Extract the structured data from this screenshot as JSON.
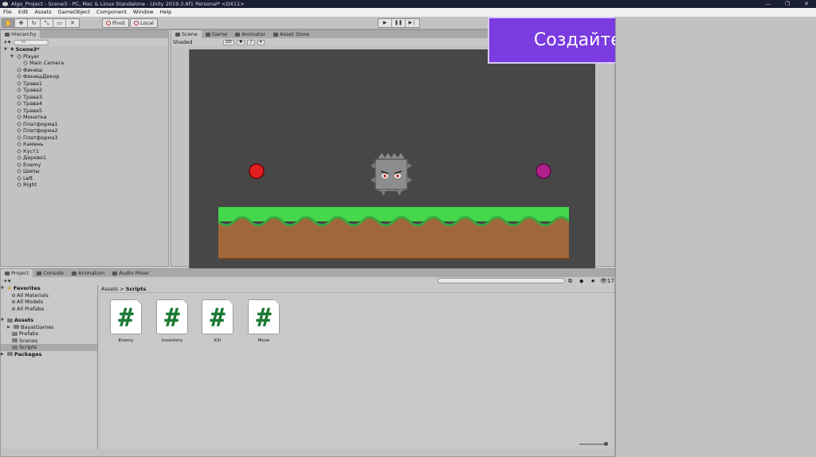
{
  "window": {
    "title": "Algo_Project - Scene3 - PC, Mac & Linux Standalone - Unity 2019.3.6f1 Personal* <DX11>",
    "controls": [
      "—",
      "❐",
      "✕"
    ]
  },
  "menu": [
    "File",
    "Edit",
    "Assets",
    "GameObject",
    "Component",
    "Window",
    "Help"
  ],
  "toolbar": {
    "pivot_label": "Pivot",
    "local_label": "Local"
  },
  "hierarchy": {
    "tab_label": "Hierarchy",
    "search_placeholder": "All",
    "scene_name": "Scene3*",
    "items": [
      {
        "label": "Player",
        "level": 1,
        "expanded": true
      },
      {
        "label": "Main Camera",
        "level": 2
      },
      {
        "label": "Финиш",
        "level": 1
      },
      {
        "label": "ФинишДекор",
        "level": 1
      },
      {
        "label": "Трава1",
        "level": 1
      },
      {
        "label": "Трава2",
        "level": 1
      },
      {
        "label": "Трава3",
        "level": 1
      },
      {
        "label": "Трава4",
        "level": 1
      },
      {
        "label": "Трава5",
        "level": 1
      },
      {
        "label": "Монетка",
        "level": 1
      },
      {
        "label": "Платформа1",
        "level": 1
      },
      {
        "label": "Платформа2",
        "level": 1
      },
      {
        "label": "Платформа3",
        "level": 1
      },
      {
        "label": "Камень",
        "level": 1
      },
      {
        "label": "Куст1",
        "level": 1
      },
      {
        "label": "Дерево1",
        "level": 1
      },
      {
        "label": "Enemy",
        "level": 1
      },
      {
        "label": "Шипы",
        "level": 1
      },
      {
        "label": "Left",
        "level": 1
      },
      {
        "label": "Right",
        "level": 1
      }
    ]
  },
  "scene": {
    "tabs": [
      "Scene",
      "Game",
      "Animator",
      "Asset Store"
    ],
    "shading": "Shaded",
    "mode_2d": "2D",
    "colors": {
      "viewport": "#474747",
      "grass": "#46d84c",
      "dirt": "#a0683a",
      "left_orb": "#e02020",
      "right_orb": "#b0208a"
    }
  },
  "callout": {
    "text": "Создайте пустой объект",
    "color": "#7a3ce0"
  },
  "project": {
    "tabs": [
      "Project",
      "Console",
      "Animation",
      "Audio Mixer"
    ],
    "count_badge": "17",
    "favorites": {
      "label": "Favorites",
      "items": [
        "All Materials",
        "All Models",
        "All Prefabs"
      ]
    },
    "assets": {
      "label": "Assets",
      "folders": [
        "BayatGames",
        "Prefabs",
        "Scenes",
        "Scripts"
      ]
    },
    "packages_label": "Packages",
    "breadcrumb": [
      "Assets",
      "Scripts"
    ],
    "scripts": [
      "Enemy",
      "Inventory",
      "Kill",
      "Move"
    ]
  }
}
